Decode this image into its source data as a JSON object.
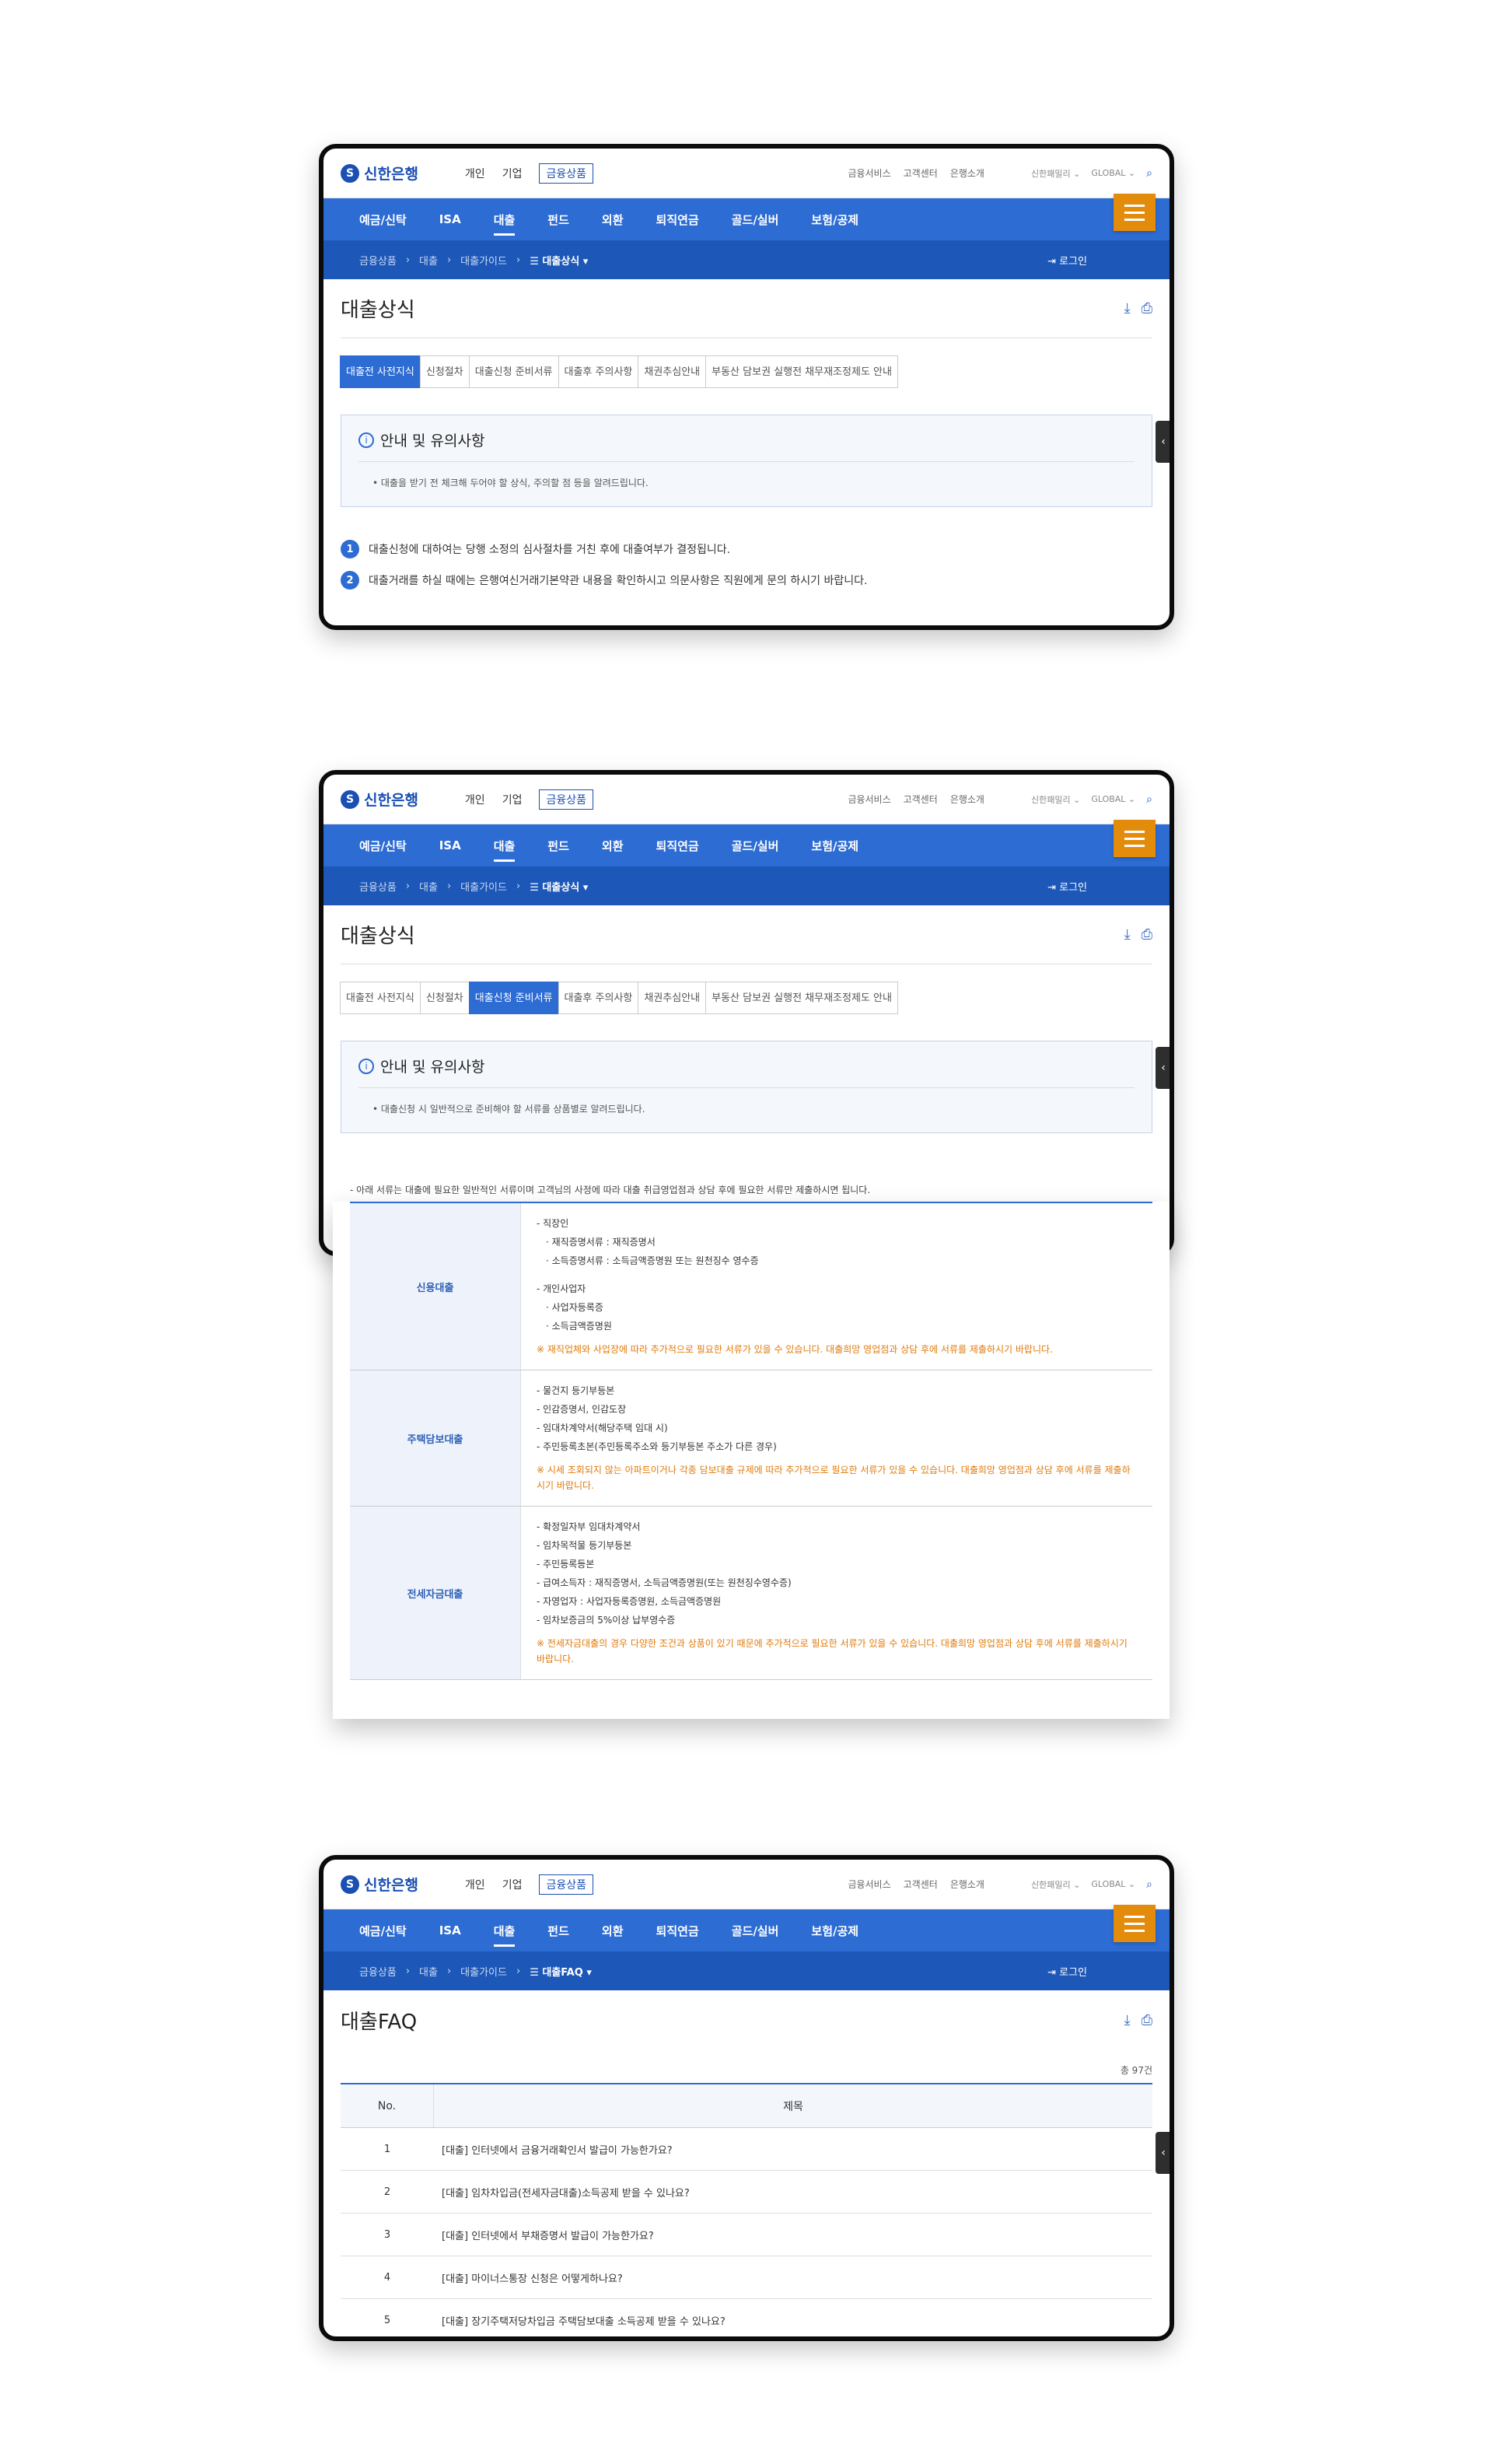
{
  "header": {
    "logo": "신한은행",
    "segments": [
      "개인",
      "기업",
      "금융상품"
    ],
    "utility": [
      "금융서비스",
      "고객센터",
      "은행소개"
    ],
    "family": "신한패밀리 ⌄",
    "global": "GLOBAL ⌄"
  },
  "gnb": [
    "예금/신탁",
    "ISA",
    "대출",
    "펀드",
    "외환",
    "퇴직연금",
    "골드/실버",
    "보험/공제"
  ],
  "breadcrumb_common": [
    "금융상품",
    "대출",
    "대출가이드"
  ],
  "login": "로그인",
  "screen1": {
    "here": "☰ 대출상식 ▾",
    "title": "대출상식",
    "tabs": [
      "대출전 사전지식",
      "신청절차",
      "대출신청 준비서류",
      "대출후 주의사항",
      "채권추심안내",
      "부동산 담보권 실행전 채무재조정제도 안내"
    ],
    "notice_title": "안내 및 유의사항",
    "notice_text": "• 대출을 받기 전 체크해 두어야 할 상식, 주의할 점 등을 알려드립니다.",
    "steps": [
      {
        "num": "1",
        "text": "대출신청에 대하여는 당행 소정의 심사절차를 거친 후에 대출여부가 결정됩니다."
      },
      {
        "num": "2",
        "text": "대출거래를 하실 때에는 은행여신거래기본약관 내용을 확인하시고 의문사항은 직원에게 문의 하시기 바랍니다."
      }
    ]
  },
  "screen2": {
    "here": "☰ 대출상식 ▾",
    "title": "대출상식",
    "notice_title": "안내 및 유의사항",
    "notice_text": "• 대출신청 시 일반적으로 준비해야 할 서류를 상품별로 알려드립니다.",
    "intro": "- 아래 서류는 대출에 필요한 일반적인 서류이며 고객님의 사정에 따라 대출 취급영업점과 상담 후에 필요한 서류만 제출하시면 됩니다.",
    "rows": [
      {
        "head": "신용대출",
        "lines": [
          "- 직장인",
          "· 재직증명서류 : 재직증명서",
          "· 소득증명서류 : 소득금액증명원 또는 원천징수 영수증",
          "- 개인사업자",
          "· 사업자등록증",
          "· 소득금액증명원"
        ],
        "warn": "※ 재직업체와 사업장에 따라 추가적으로 필요한 서류가 있을 수 있습니다. 대출희망 영업점과 상담 후에 서류를 제출하시기 바랍니다."
      },
      {
        "head": "주택담보대출",
        "lines": [
          "- 물건지 등기부등본",
          "- 인감증명서, 인감도장",
          "- 임대차계약서(해당주택 임대 시)",
          "- 주민등록초본(주민등록주소와 등기부등본 주소가 다른 경우)"
        ],
        "warn": "※ 시세 조회되지 않는 아파트이거나 각종 담보대출 규제에 따라 추가적으로 필요한 서류가 있을 수 있습니다. 대출희망 영업점과 상담 후에 서류를 제출하시기 바랍니다."
      },
      {
        "head": "전세자금대출",
        "lines": [
          "- 확정일자부 임대차계약서",
          "- 임차목적물 등기부등본",
          "- 주민등록등본",
          "- 급여소득자 : 재직증명서, 소득금액증명원(또는 원천징수영수증)",
          "- 자영업자 : 사업자등록증명원, 소득금액증명원",
          "- 임차보증금의 5%이상 납부영수증"
        ],
        "warn": "※ 전세자금대출의 경우 다양한 조건과 상품이 있기 때문에 추가적으로 필요한 서류가 있을 수 있습니다. 대출희망 영업점과 상담 후에 서류를 제출하시기 바랍니다."
      }
    ]
  },
  "screen3": {
    "here": "☰ 대출FAQ ▾",
    "title": "대출FAQ",
    "total": "총 97건",
    "col_no": "No.",
    "col_title": "제목",
    "rows": [
      {
        "no": "1",
        "title": "[대출] 인터넷에서 금융거래확인서 발급이 가능한가요?"
      },
      {
        "no": "2",
        "title": "[대출] 임차차입금(전세자금대출)소득공제 받을 수 있나요?"
      },
      {
        "no": "3",
        "title": "[대출] 인터넷에서 부채증명서 발급이 가능한가요?"
      },
      {
        "no": "4",
        "title": "[대출] 마이너스통장 신청은 어떻게하나요?"
      },
      {
        "no": "5",
        "title": "[대출] 장기주택저당차입금 주택담보대출 소득공제 받을 수 있나요?"
      }
    ]
  }
}
